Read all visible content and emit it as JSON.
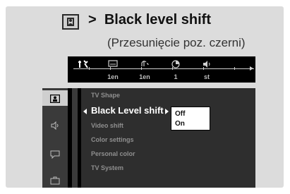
{
  "caption": {
    "separator": ">",
    "title": "Black level shift",
    "subtitle": "(Przesunięcie poz. czerni)"
  },
  "menubar": {
    "items": [
      {
        "icon": "settings-tools-icon",
        "value": ""
      },
      {
        "icon": "subtitle-icon",
        "value": "1en"
      },
      {
        "icon": "audio-icon",
        "value": "1en"
      },
      {
        "icon": "angle-icon",
        "value": "1"
      },
      {
        "icon": "sound-icon",
        "value": "st"
      }
    ]
  },
  "sidebar": {
    "icons": [
      "picture-icon",
      "speaker-icon",
      "chat-icon",
      "briefcase-icon"
    ]
  },
  "menu": {
    "items": [
      "TV Shape",
      "Black Level shift",
      "Video shift",
      "Color settings",
      "Personal color",
      "TV System"
    ],
    "active_index": 1
  },
  "submenu": {
    "options": [
      "Off",
      "On"
    ]
  }
}
